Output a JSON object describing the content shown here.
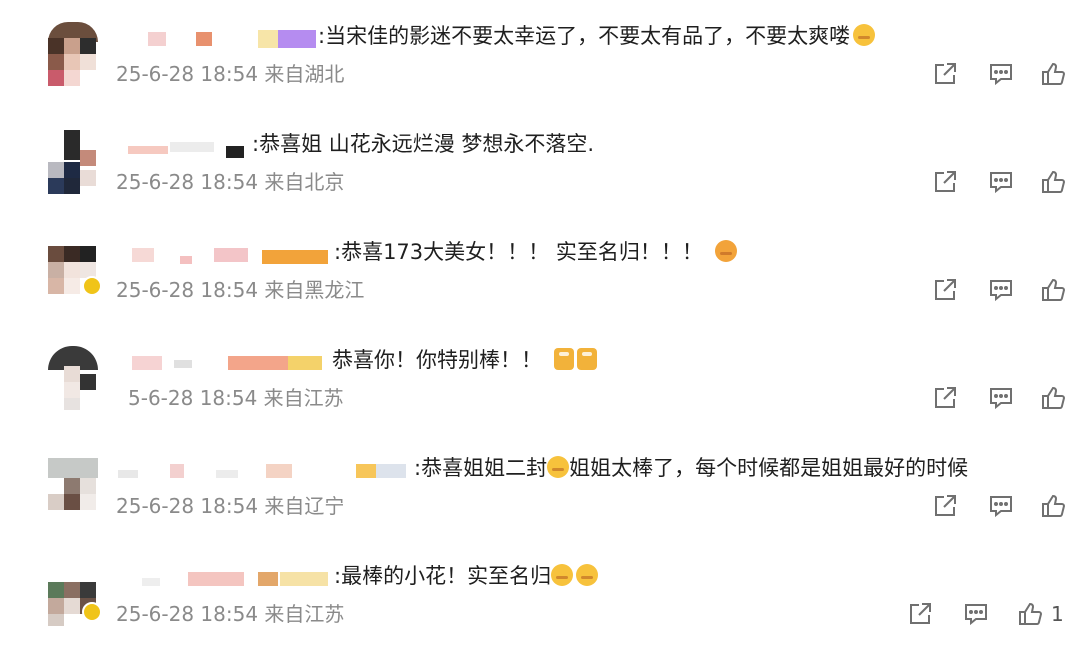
{
  "comments": [
    {
      "text": ":当宋佳的影迷不要太幸运了，不要太有品了，不要太爽喽",
      "emojis": [
        "laughing-emoji"
      ],
      "meta": "25-6-28 18:54 来自湖北",
      "like_count": ""
    },
    {
      "text": ":恭喜姐 山花永远烂漫 梦想永不落空.",
      "emojis": [],
      "meta": "25-6-28 18:54 来自北京",
      "like_count": ""
    },
    {
      "text": ":恭喜173大美女！！！ 实至名归！！！",
      "emojis": [
        "grin-emoji"
      ],
      "meta": "25-6-28 18:54 来自黑龙江",
      "like_count": ""
    },
    {
      "text": "恭喜你！你特别棒！！",
      "emojis": [
        "beer-emoji",
        "beer-emoji"
      ],
      "meta": "5-6-28 18:54 来自江苏",
      "like_count": ""
    },
    {
      "text": ":恭喜姐姐二封",
      "emojis": [
        "crying-emoji"
      ],
      "text_after": "姐姐太棒了，每个时候都是姐姐最好的时候",
      "meta": "25-6-28 18:54 来自辽宁",
      "like_count": ""
    },
    {
      "text": ":最棒的小花！实至名归",
      "emojis": [
        "screaming-emoji",
        "screaming-emoji"
      ],
      "meta": "25-6-28 18:54 来自江苏",
      "like_count": "1"
    }
  ],
  "colors": {
    "meta_gray": "#8a8a8a",
    "icon_gray": "#707070",
    "emoji_yellow": "#f7c23c",
    "emoji_orange": "#f2a33a"
  }
}
